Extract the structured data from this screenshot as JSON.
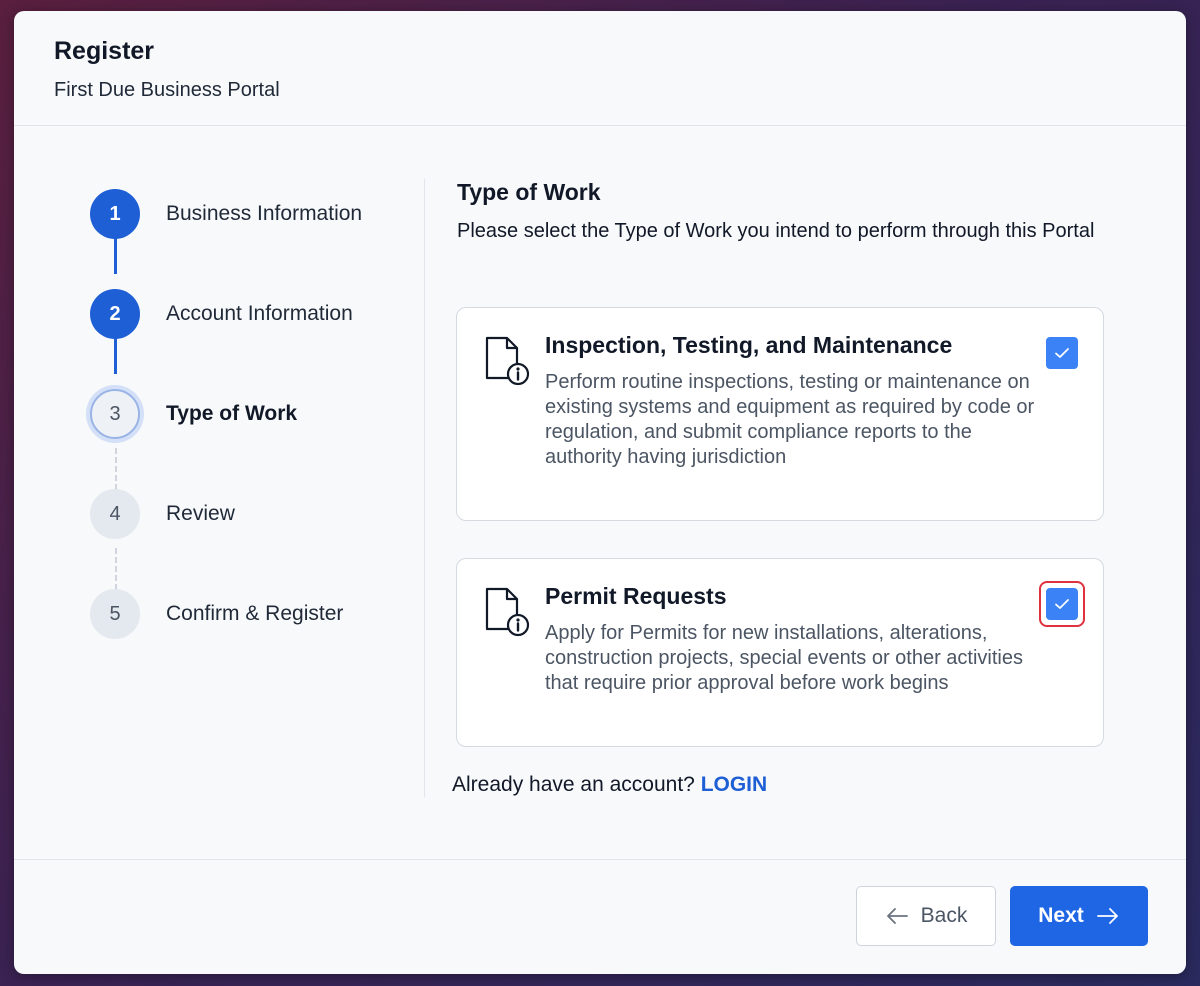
{
  "header": {
    "title": "Register",
    "subtitle": "First Due Business Portal"
  },
  "stepper": {
    "steps": [
      {
        "number": "1",
        "label": "Business Information",
        "state": "completed"
      },
      {
        "number": "2",
        "label": "Account Information",
        "state": "completed"
      },
      {
        "number": "3",
        "label": "Type of Work",
        "state": "active"
      },
      {
        "number": "4",
        "label": "Review",
        "state": "upcoming"
      },
      {
        "number": "5",
        "label": "Confirm & Register",
        "state": "upcoming"
      }
    ]
  },
  "content": {
    "title": "Type of Work",
    "description": "Please select the Type of Work you intend to perform through this Portal",
    "cards": [
      {
        "icon": "document-info-icon",
        "title": "Inspection, Testing, and Maintenance",
        "description": "Perform routine inspections, testing or maintenance on existing systems and equipment as required by code or regulation, and submit compliance reports to the authority having jurisdiction",
        "checked": true
      },
      {
        "icon": "document-info-icon",
        "title": "Permit Requests",
        "description": "Apply for Permits for new installations, alterations, construction projects, special events or other activities that require prior approval before work begins",
        "checked": true
      }
    ],
    "login_prompt": "Already have an account?",
    "login_link": "LOGIN"
  },
  "footer": {
    "back_label": "Back",
    "next_label": "Next"
  },
  "colors": {
    "primary": "#1f66e5",
    "checkbox": "#3b82f6",
    "focus_ring": "#e0313f"
  }
}
